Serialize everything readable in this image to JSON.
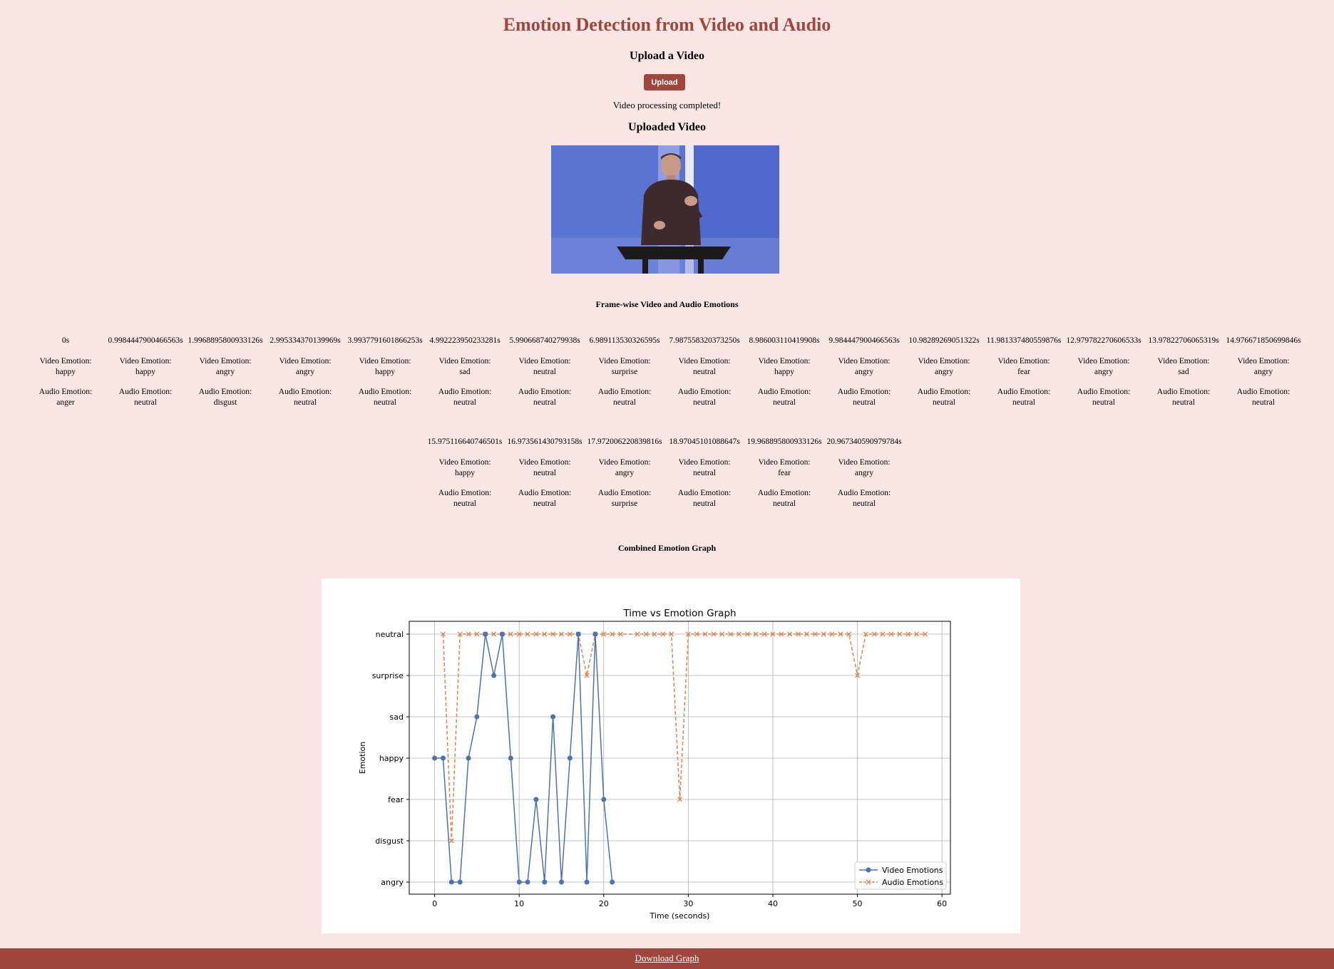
{
  "header": {
    "title": "Emotion Detection from Video and Audio"
  },
  "upload": {
    "heading": "Upload a Video",
    "button_label": "Upload",
    "status": "Video processing completed!"
  },
  "video": {
    "heading": "Uploaded Video"
  },
  "frames": {
    "heading": "Frame-wise Video and Audio Emotions",
    "video_prefix": "Video Emotion:",
    "audio_prefix": "Audio Emotion:",
    "rows": [
      [
        {
          "time": "0s",
          "video": "happy",
          "audio": "anger"
        },
        {
          "time": "0.9984447900466563s",
          "video": "happy",
          "audio": "neutral"
        },
        {
          "time": "1.9968895800933126s",
          "video": "angry",
          "audio": "disgust"
        },
        {
          "time": "2.995334370139969s",
          "video": "angry",
          "audio": "neutral"
        },
        {
          "time": "3.9937791601866253s",
          "video": "happy",
          "audio": "neutral"
        },
        {
          "time": "4.992223950233281s",
          "video": "sad",
          "audio": "neutral"
        },
        {
          "time": "5.990668740279938s",
          "video": "neutral",
          "audio": "neutral"
        },
        {
          "time": "6.989113530326595s",
          "video": "surprise",
          "audio": "neutral"
        },
        {
          "time": "7.987558320373250s",
          "video": "neutral",
          "audio": "neutral"
        },
        {
          "time": "8.986003110419908s",
          "video": "happy",
          "audio": "neutral"
        },
        {
          "time": "9.984447900466563s",
          "video": "angry",
          "audio": "neutral"
        },
        {
          "time": "10.98289269051322s",
          "video": "angry",
          "audio": "neutral"
        },
        {
          "time": "11.981337480559876s",
          "video": "fear",
          "audio": "neutral"
        },
        {
          "time": "12.979782270606533s",
          "video": "angry",
          "audio": "neutral"
        },
        {
          "time": "13.97822706065319s",
          "video": "sad",
          "audio": "neutral"
        },
        {
          "time": "14.976671850699846s",
          "video": "angry",
          "audio": "neutral"
        }
      ],
      [
        {
          "time": "15.975116640746501s",
          "video": "happy",
          "audio": "neutral"
        },
        {
          "time": "16.973561430793158s",
          "video": "neutral",
          "audio": "neutral"
        },
        {
          "time": "17.972006220839816s",
          "video": "angry",
          "audio": "surprise"
        },
        {
          "time": "18.97045101088647s",
          "video": "neutral",
          "audio": "neutral"
        },
        {
          "time": "19.968895800933126s",
          "video": "fear",
          "audio": "neutral"
        },
        {
          "time": "20.967340590979784s",
          "video": "angry",
          "audio": "neutral"
        }
      ]
    ]
  },
  "graph": {
    "heading": "Combined Emotion Graph"
  },
  "footer": {
    "download_label": "Download Graph"
  },
  "chart_data": {
    "type": "line",
    "title": "Time vs Emotion Graph",
    "xlabel": "Time (seconds)",
    "ylabel": "Emotion",
    "categories": [
      "angry",
      "disgust",
      "fear",
      "happy",
      "sad",
      "surprise",
      "neutral"
    ],
    "xlim": [
      -3,
      61
    ],
    "xticks": [
      0,
      10,
      20,
      30,
      40,
      50,
      60
    ],
    "grid": true,
    "legend": "lower-right",
    "colors": {
      "video": "#4c72b0",
      "audio": "#dd8452"
    },
    "series": [
      {
        "name": "Video Emotions",
        "marker": "o",
        "linestyle": "solid",
        "x": [
          0,
          1,
          2,
          3,
          4,
          5,
          6,
          7,
          8,
          9,
          10,
          11,
          12,
          13,
          14,
          15,
          16,
          17,
          18,
          19,
          20,
          21
        ],
        "y": [
          "happy",
          "happy",
          "angry",
          "angry",
          "happy",
          "sad",
          "neutral",
          "surprise",
          "neutral",
          "happy",
          "angry",
          "angry",
          "fear",
          "angry",
          "sad",
          "angry",
          "happy",
          "neutral",
          "angry",
          "neutral",
          "fear",
          "angry"
        ]
      },
      {
        "name": "Audio Emotions",
        "marker": "x",
        "linestyle": "dashed",
        "x": [
          1,
          2,
          3,
          4,
          5,
          6,
          7,
          8,
          9,
          10,
          11,
          12,
          13,
          14,
          15,
          16,
          17,
          18,
          19,
          20,
          21,
          22,
          24,
          25,
          26,
          27,
          28,
          29,
          30,
          31,
          32,
          33,
          34,
          35,
          36,
          37,
          38,
          39,
          40,
          41,
          42,
          43,
          44,
          45,
          46,
          47,
          48,
          49,
          50,
          51,
          52,
          53,
          54,
          55,
          56,
          57,
          58
        ],
        "y": [
          "neutral",
          "disgust",
          "neutral",
          "neutral",
          "neutral",
          "neutral",
          "neutral",
          "neutral",
          "neutral",
          "neutral",
          "neutral",
          "neutral",
          "neutral",
          "neutral",
          "neutral",
          "neutral",
          "neutral",
          "surprise",
          "neutral",
          "neutral",
          "neutral",
          "neutral",
          "neutral",
          "neutral",
          "neutral",
          "neutral",
          "neutral",
          "fear",
          "neutral",
          "neutral",
          "neutral",
          "neutral",
          "neutral",
          "neutral",
          "neutral",
          "neutral",
          "neutral",
          "neutral",
          "neutral",
          "neutral",
          "neutral",
          "neutral",
          "neutral",
          "neutral",
          "neutral",
          "neutral",
          "neutral",
          "neutral",
          "surprise",
          "neutral",
          "neutral",
          "neutral",
          "neutral",
          "neutral",
          "neutral",
          "neutral",
          "neutral"
        ]
      }
    ]
  }
}
